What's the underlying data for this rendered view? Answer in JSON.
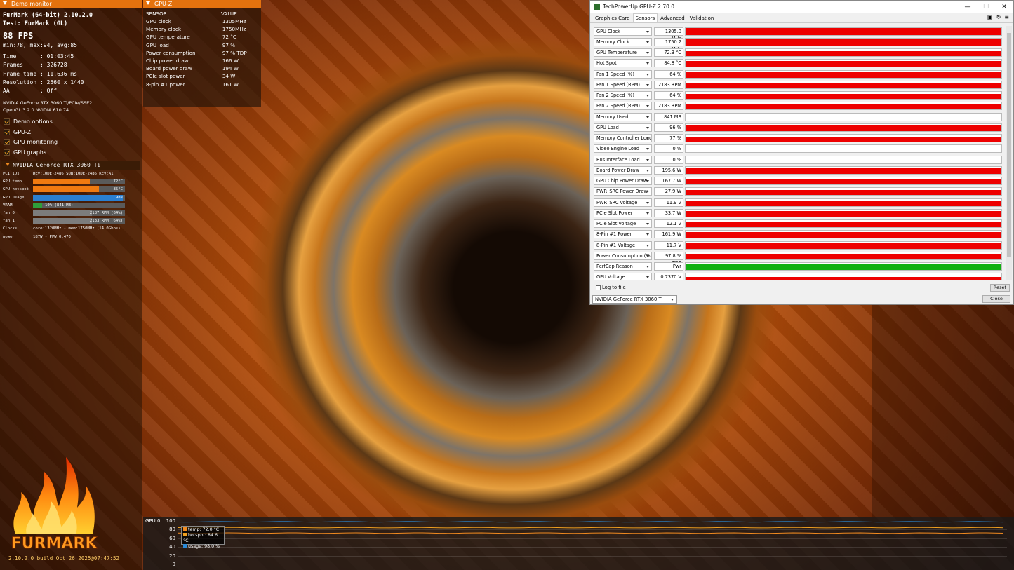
{
  "demo": {
    "header": "Demo monitor",
    "title": "FurMark (64-bit) 2.10.2.0",
    "test": "Test: FurMark (GL)",
    "fps": "88 FPS",
    "minmax": "min:78, max:94, avg:85",
    "stats": [
      {
        "k": "Time       ",
        "v": ": 01:03:45"
      },
      {
        "k": "Frames     ",
        "v": ": 326728"
      },
      {
        "k": "Frame time ",
        "v": ": 11.636 ms"
      },
      {
        "k": "Resolution ",
        "v": ": 2560 x 1440"
      },
      {
        "k": "AA         ",
        "v": ": Off"
      }
    ],
    "gpu_line1": "NVIDIA GeForce RTX 3060 Ti/PCIe/SSE2",
    "gpu_line2": "OpenGL 3.2.0 NVIDIA 610.74",
    "options": [
      "Demo options",
      "GPU-Z",
      "GPU monitoring",
      "GPU graphs"
    ],
    "gpu_header": "NVIDIA GeForce RTX 3060 Ti",
    "gpu_rows": [
      {
        "label": "PCI IDs",
        "text": "DEV:10DE-2486 SUB:10DE-2486 REV:A1"
      },
      {
        "label": "GPU temp",
        "bar": "72°C",
        "fill": 0.62,
        "color": "#f07a10"
      },
      {
        "label": "GPU hotspot",
        "bar": "85°C",
        "fill": 0.72,
        "color": "#f07a10"
      },
      {
        "label": "GPU usage",
        "bar": "98%",
        "fill": 0.98,
        "color": "#2a7fd0"
      },
      {
        "label": "VRAM",
        "bar": "10% (841 MB)",
        "fill": 0.1,
        "color": "#2f9e3a",
        "left": true
      },
      {
        "label": "fan 0",
        "bar": "2187 RPM (64%)",
        "fill": 0.64,
        "color": "#7c7c7c"
      },
      {
        "label": "fan 1",
        "bar": "2183 RPM (64%)",
        "fill": 0.64,
        "color": "#7c7c7c"
      },
      {
        "label": "Clocks",
        "text": "core:1320MHz - mem:1750MHz (14.0Gbps)"
      },
      {
        "label": "power",
        "text": "187W - PPW:0.470"
      }
    ],
    "logo_text": "FURMARK",
    "build": "2.10.2.0 build Oct 26 2025@07:47:52"
  },
  "gpuz_overlay": {
    "header": "GPU-Z",
    "col_sensor": "SENSOR",
    "col_value": "VALUE",
    "rows": [
      [
        "GPU clock",
        "1305MHz"
      ],
      [
        "Memory clock",
        "1750MHz"
      ],
      [
        "GPU temperature",
        "72 °C"
      ],
      [
        "GPU load",
        "97 %"
      ],
      [
        "Power consumption",
        "97 % TDP"
      ],
      [
        "Chip power draw",
        "166 W"
      ],
      [
        "Board power draw",
        "194 W"
      ],
      [
        "PCIe slot power",
        "34 W"
      ],
      [
        "8-pin #1 power",
        "161 W"
      ]
    ]
  },
  "graph": {
    "label": "GPU 0",
    "yticks": [
      "100",
      "80",
      "60",
      "40",
      "20",
      "0"
    ],
    "legend": [
      {
        "text": "temp: 72.0 °C",
        "color": "#f08a20"
      },
      {
        "text": "hotspot: 84.6 °C",
        "color": "#f0a020"
      },
      {
        "text": "usage: 98.0 %",
        "color": "#2a8ad8"
      }
    ],
    "series": {
      "temp": 72.0,
      "hotspot": 84.6,
      "usage": 98.0
    }
  },
  "window": {
    "title": "TechPowerUp GPU-Z 2.70.0",
    "controls": [
      "—",
      "☐",
      "✕"
    ],
    "tabs": [
      "Graphics Card",
      "Sensors",
      "Advanced",
      "Validation"
    ],
    "active_tab": 1,
    "sensors": [
      {
        "name": "GPU Clock",
        "value": "1305.0 MHz",
        "fill": 0.93,
        "color": "#ee0000"
      },
      {
        "name": "Memory Clock",
        "value": "1750.2 MHz",
        "fill": 0.93,
        "color": "#ee0000"
      },
      {
        "name": "GPU Temperature",
        "value": "72.3 °C",
        "fill": 0.75,
        "color": "#ee0000"
      },
      {
        "name": "Hot Spot",
        "value": "84.8 °C",
        "fill": 0.8,
        "color": "#ee0000"
      },
      {
        "name": "Fan 1 Speed (%)",
        "value": "64 %",
        "fill": 0.75,
        "color": "#ee0000"
      },
      {
        "name": "Fan 1 Speed (RPM)",
        "value": "2183 RPM",
        "fill": 0.75,
        "color": "#ee0000"
      },
      {
        "name": "Fan 2 Speed (%)",
        "value": "64 %",
        "fill": 0.75,
        "color": "#ee0000"
      },
      {
        "name": "Fan 2 Speed (RPM)",
        "value": "2183 RPM",
        "fill": 0.75,
        "color": "#ee0000"
      },
      {
        "name": "Memory Used",
        "value": "841 MB",
        "fill": 0.0,
        "color": "#ee0000"
      },
      {
        "name": "GPU Load",
        "value": "96 %",
        "fill": 0.9,
        "color": "#ee0000"
      },
      {
        "name": "Memory Controller Load",
        "value": "77 %",
        "fill": 0.75,
        "color": "#ee0000"
      },
      {
        "name": "Video Engine Load",
        "value": "0 %",
        "fill": 0.0,
        "color": "#ee0000"
      },
      {
        "name": "Bus Interface Load",
        "value": "0 %",
        "fill": 0.0,
        "color": "#ee0000"
      },
      {
        "name": "Board Power Draw",
        "value": "195.6 W",
        "fill": 0.8,
        "color": "#ee0000"
      },
      {
        "name": "GPU Chip Power Draw",
        "value": "167.7 W",
        "fill": 0.8,
        "color": "#ee0000"
      },
      {
        "name": "PWR_SRC Power Draw",
        "value": "27.9 W",
        "fill": 0.75,
        "color": "#ee0000"
      },
      {
        "name": "PWR_SRC Voltage",
        "value": "11.9 V",
        "fill": 0.8,
        "color": "#ee0000"
      },
      {
        "name": "PCIe Slot Power",
        "value": "33.7 W",
        "fill": 0.75,
        "color": "#ee0000"
      },
      {
        "name": "PCIe Slot Voltage",
        "value": "12.1 V",
        "fill": 0.8,
        "color": "#ee0000"
      },
      {
        "name": "8-Pin #1 Power",
        "value": "161.9 W",
        "fill": 0.8,
        "color": "#ee0000"
      },
      {
        "name": "8-Pin #1 Voltage",
        "value": "11.7 V",
        "fill": 0.8,
        "color": "#ee0000"
      },
      {
        "name": "Power Consumption (%)",
        "value": "97.8 % TDP",
        "fill": 0.8,
        "color": "#ee0000"
      },
      {
        "name": "PerfCap Reason",
        "value": "Pwr",
        "fill": 0.85,
        "color": "#10b010"
      },
      {
        "name": "GPU Voltage",
        "value": "0.7370 V",
        "fill": 0.5,
        "color": "#ee0000"
      }
    ],
    "log_to_file": "Log to file",
    "reset": "Reset",
    "gpu_select": "NVIDIA GeForce RTX 3060 Ti",
    "close": "Close"
  }
}
